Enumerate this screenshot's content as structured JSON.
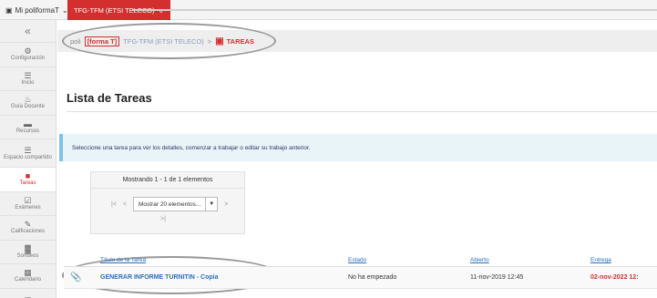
{
  "topbar": {
    "site_menu_label": "Mi poliformaT",
    "site_tab_label": "TFG-TFM (ETSI TELECO)",
    "chevron": "⌵"
  },
  "sidebar": {
    "collapse_glyph": "«",
    "items": [
      {
        "label": "Configuración",
        "icon": "gear-icon",
        "glyph": "⚙"
      },
      {
        "label": "Inicio",
        "icon": "home-icon",
        "glyph": "☰"
      },
      {
        "label": "Guía Docente",
        "icon": "guide-icon",
        "glyph": "♨"
      },
      {
        "label": "Recursos",
        "icon": "folder-icon",
        "glyph": "▬"
      },
      {
        "label": "Espacio compartido",
        "icon": "shared-space-icon",
        "glyph": "☰"
      },
      {
        "label": "Tareas",
        "icon": "tasks-icon",
        "glyph": "■"
      },
      {
        "label": "Exámenes",
        "icon": "exam-icon",
        "glyph": "☑"
      },
      {
        "label": "Calificaciones",
        "icon": "grades-icon",
        "glyph": "✎"
      },
      {
        "label": "Sondeos",
        "icon": "poll-icon",
        "glyph": "▓"
      },
      {
        "label": "Calendario",
        "icon": "calendar-icon",
        "glyph": "▦"
      },
      {
        "label": "",
        "icon": "megaphone-icon",
        "glyph": "✉"
      }
    ]
  },
  "breadcrumb": {
    "prefix": "poli",
    "tag": "[forma T]",
    "site": "TFG-TFM (ETSI TELECO)",
    "separator": ">",
    "current": "TAREAS"
  },
  "page": {
    "title": "Lista de Tareas",
    "info": "Seleccione una tarea para ver los detalles, comenzar a trabajar o editar su trabajo anterior."
  },
  "pager": {
    "showing": "Mostrando 1 - 1 de 1 elementos",
    "first": "|<",
    "prev": "<",
    "select_value": "Mostrar 20 elementos...",
    "next": ">",
    "last": ">|"
  },
  "table": {
    "headers": {
      "title": "Título de la Tarea",
      "status": "Estado",
      "open": "Abierto",
      "due": "Entrega"
    },
    "rows": [
      {
        "title": "GENERAR INFORME TURNITIN - Copia",
        "status": "No ha empezado",
        "open": "11-nov-2019 12:45",
        "due": "02-nov-2022 12:"
      }
    ]
  },
  "colors": {
    "accent": "#d32f2f",
    "link": "#2a6fbd",
    "info_border": "#7cc3e8"
  }
}
